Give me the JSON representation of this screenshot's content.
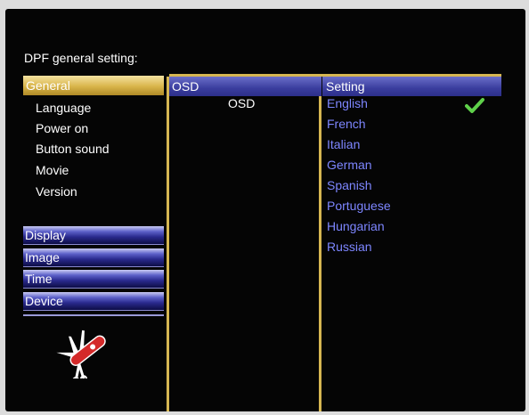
{
  "title": "DPF general setting:",
  "left_panel": {
    "active_category": "General",
    "sub_items": [
      "Language",
      "Power on",
      "Button sound",
      "Movie",
      "Version"
    ],
    "categories": [
      "Display",
      "Image",
      "Time",
      "Device"
    ]
  },
  "middle_column": {
    "header": "OSD",
    "value": "OSD"
  },
  "right_column": {
    "header": "Setting",
    "options": [
      "English",
      "French",
      "Italian",
      "German",
      "Spanish",
      "Portuguese",
      "Hungarian",
      "Russian"
    ],
    "selected": "English"
  },
  "icons": {
    "selected_marker": "checkmark-icon",
    "tool_graphic": "swiss-knife-icon"
  },
  "colors": {
    "accent_gold": "#d6b651",
    "header_blue": "#3a3d9e",
    "option_text": "#7d86ff",
    "check_green": "#5fd04a"
  }
}
